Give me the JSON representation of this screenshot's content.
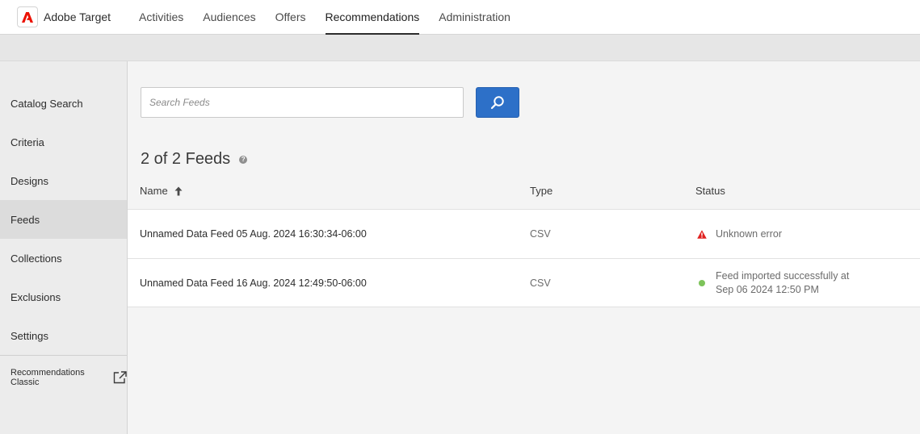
{
  "app": {
    "name": "Adobe Target",
    "logo_letter": "A"
  },
  "nav": {
    "items": [
      {
        "label": "Activities",
        "active": false
      },
      {
        "label": "Audiences",
        "active": false
      },
      {
        "label": "Offers",
        "active": false
      },
      {
        "label": "Recommendations",
        "active": true
      },
      {
        "label": "Administration",
        "active": false
      }
    ]
  },
  "sidebar": {
    "items": [
      {
        "label": "Catalog Search",
        "active": false
      },
      {
        "label": "Criteria",
        "active": false
      },
      {
        "label": "Designs",
        "active": false
      },
      {
        "label": "Feeds",
        "active": true
      },
      {
        "label": "Collections",
        "active": false
      },
      {
        "label": "Exclusions",
        "active": false
      },
      {
        "label": "Settings",
        "active": false
      }
    ],
    "classic_link": "Recommendations Classic",
    "classic_icon": "external-link-icon"
  },
  "search": {
    "placeholder": "Search Feeds",
    "value": "",
    "button_icon": "search-icon"
  },
  "feeds": {
    "count_label": "2 of 2 Feeds",
    "help_icon": "help-icon",
    "columns": {
      "name": "Name",
      "type": "Type",
      "status": "Status"
    },
    "sort_icon": "sort-ascending-icon",
    "rows": [
      {
        "name": "Unnamed Data Feed 05 Aug. 2024 16:30:34-06:00",
        "type": "CSV",
        "status": "Unknown error",
        "status_kind": "error",
        "status_icon": "warning-icon"
      },
      {
        "name": "Unnamed Data Feed 16 Aug. 2024 12:49:50-06:00",
        "type": "CSV",
        "status": "Feed imported successfully at Sep 06 2024 12:50 PM",
        "status_kind": "success",
        "status_icon": "success-dot-icon"
      }
    ]
  },
  "colors": {
    "accent": "#2d70c8",
    "error": "#e0201f",
    "success": "#7dc35a",
    "logo_red": "#eb1000"
  }
}
